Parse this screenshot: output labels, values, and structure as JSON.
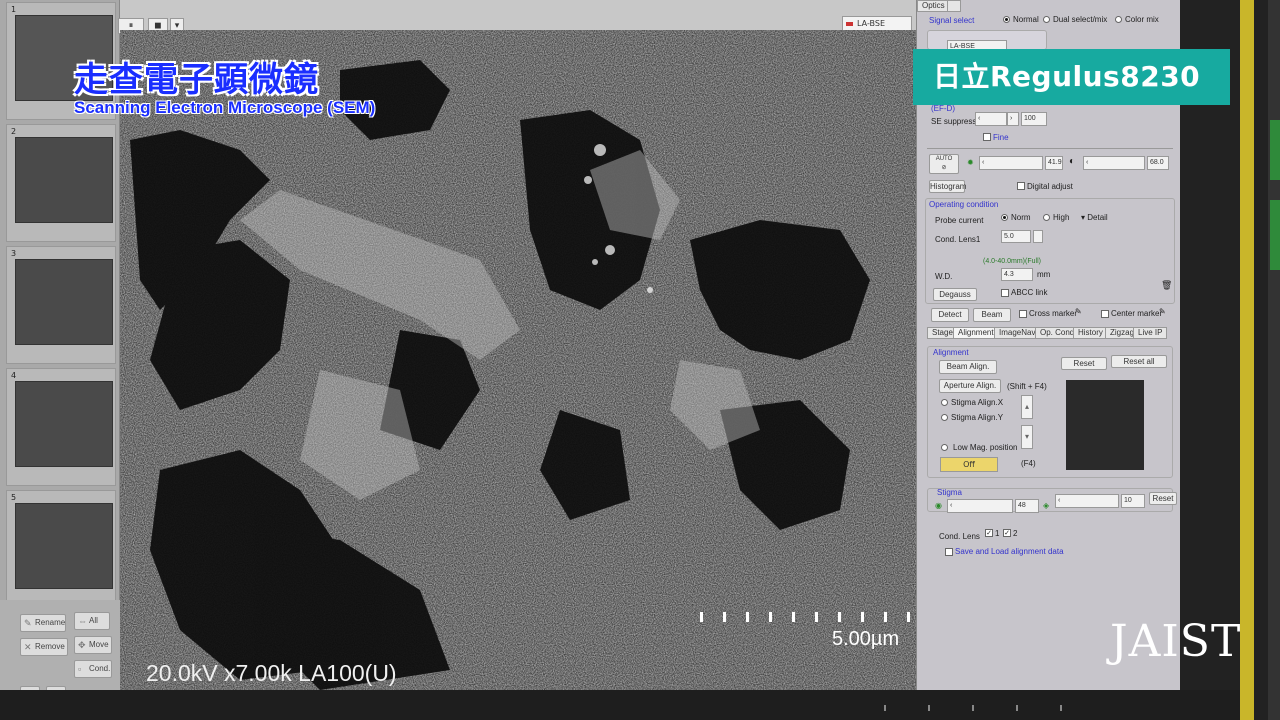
{
  "overlay": {
    "title_zh": "走查電子顕微鏡",
    "title_en": "Scanning Electron Microscope (SEM)",
    "brand": "日立Regulus8230",
    "logo": "JAIST"
  },
  "viewer": {
    "info": "20.0kV x7.00k LA100(U)",
    "scale_label": "5.00µm",
    "signal_label": "LA-BSE"
  },
  "thumbnails": {
    "items": [
      {
        "num": "1"
      },
      {
        "num": "2"
      },
      {
        "num": "3"
      },
      {
        "num": "4"
      },
      {
        "num": "5"
      }
    ],
    "buttons": {
      "rename": "Rename",
      "all": "All",
      "remove": "Remove",
      "move": "Move",
      "cond": "Cond."
    }
  },
  "panel": {
    "tab_optics": "Optics",
    "signal_select": {
      "title": "Signal select",
      "opt_normal": "Normal",
      "opt_dual": "Dual select/mix",
      "opt_color": "Color mix",
      "combo": "LA-BSE"
    },
    "se_suppress": {
      "head": "(EF-D)",
      "label": "SE suppress",
      "value": "100",
      "fine": "Fine"
    },
    "auto": {
      "label": "AUTO",
      "brightness": "41.9",
      "contrast": "68.0",
      "histogram": "Histogram",
      "digital_adjust": "Digital adjust"
    },
    "operating": {
      "title": "Operating condition",
      "probe_label": "Probe current",
      "opt_norm": "Norm",
      "opt_high": "High",
      "detail": "Detail",
      "cond_lens1": "Cond. Lens1",
      "cond_val": "5.0",
      "wd_range": "(4.0-40.0mm)(Full)",
      "wd_label": "W.D.",
      "wd_val": "4.3",
      "wd_unit": "mm",
      "degauss": "Degauss",
      "abcc": "ABCC link"
    },
    "detect": "Detect",
    "beam": "Beam",
    "cross_marker": "Cross marker",
    "center_marker": "Center marker",
    "tabs": [
      "Stage",
      "Alignment",
      "ImageNavi",
      "Op. Cond",
      "History",
      "Zigzag",
      "Live IP"
    ],
    "alignment": {
      "title": "Alignment",
      "beam_align": "Beam Align.",
      "aperture_align": "Aperture Align.",
      "shift": "(Shift + F4)",
      "stigma_x": "Stigma Align.X",
      "stigma_y": "Stigma Align.Y",
      "low_mag": "Low Mag. position",
      "off": "Off",
      "f4": "(F4)",
      "reset": "Reset",
      "reset_all": "Reset all"
    },
    "stigma": {
      "title": "Stigma",
      "x_val": "48",
      "y_val": "10",
      "reset": "Reset"
    },
    "cond_lens": {
      "label": "Cond. Lens",
      "one": "1",
      "two": "2",
      "save": "Save and Load alignment data"
    }
  }
}
